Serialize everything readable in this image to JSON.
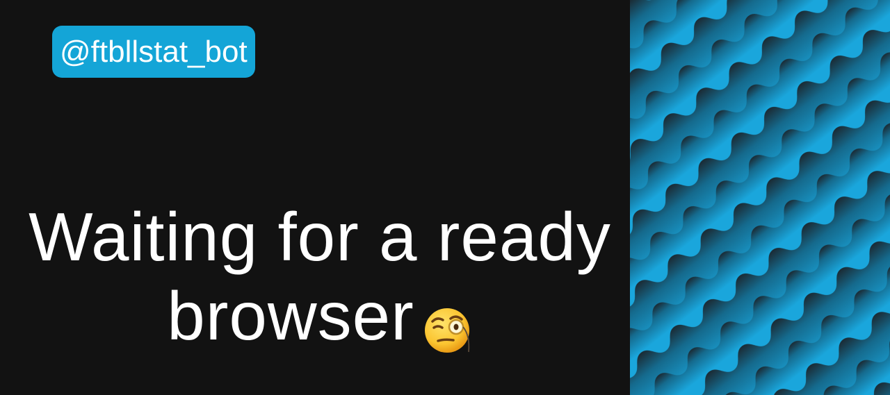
{
  "badge": {
    "handle": "@ftbllstat_bot"
  },
  "headline": {
    "line1": "Waiting for a ready",
    "line2": "browser"
  },
  "icons": {
    "emoji": "face-with-monocle-icon",
    "pattern": "wavy-stripes-pattern"
  },
  "colors": {
    "background": "#121212",
    "accent": "#14a5d7",
    "text": "#ffffff",
    "pattern_light": "#1aa6dc",
    "pattern_dark": "#1b2a33"
  }
}
